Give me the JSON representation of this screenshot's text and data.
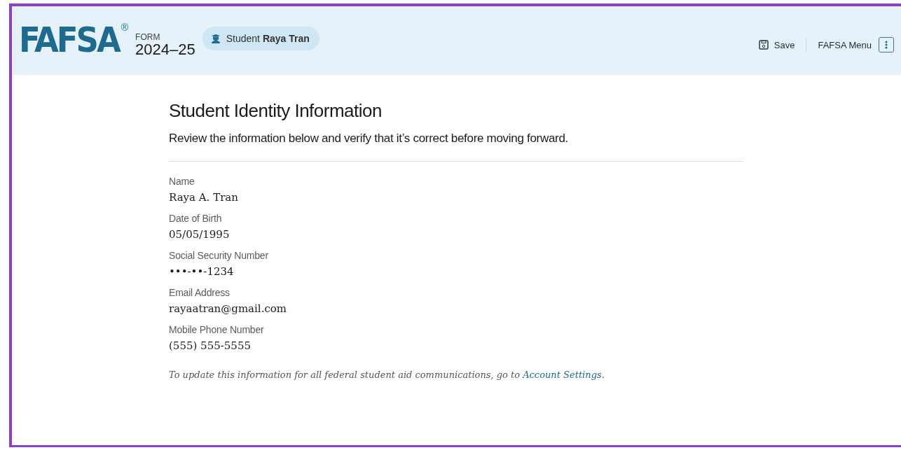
{
  "header": {
    "logo": "FAFSA",
    "registered_mark": "®",
    "form_label": "FORM",
    "form_year": "2024–25",
    "role_badge": {
      "role": "Student",
      "name": "Raya Tran"
    },
    "save_button": "Save",
    "menu_button": "FAFSA Menu"
  },
  "page": {
    "title": "Student Identity Information",
    "subtitle": "Review the information below and verify that it’s correct before moving forward.",
    "fields": [
      {
        "label": "Name",
        "value": "Raya A. Tran"
      },
      {
        "label": "Date of Birth",
        "value": "05/05/1995"
      },
      {
        "label": "Social Security Number",
        "value": "•••-••-1234"
      },
      {
        "label": "Email Address",
        "value": "rayaatran@gmail.com"
      },
      {
        "label": "Mobile Phone Number",
        "value": "(555) 555-5555"
      }
    ],
    "note": {
      "text": "To update this information for all federal student aid communications, go to ",
      "link": "Account Settings",
      "after": "."
    }
  }
}
